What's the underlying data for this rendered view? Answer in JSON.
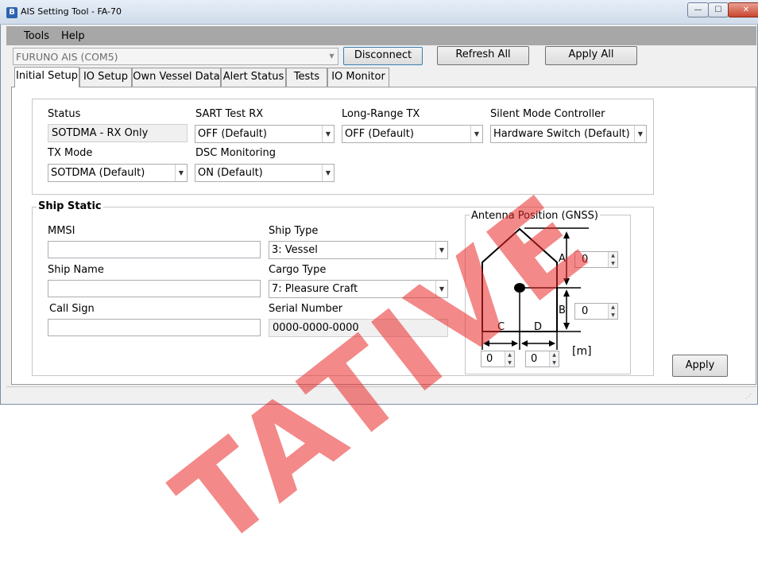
{
  "window": {
    "title": "AIS Setting Tool - FA-70",
    "app_icon": "B",
    "min": "—",
    "max": "☐",
    "close": "✕"
  },
  "menu": {
    "tools": "Tools",
    "help": "Help"
  },
  "connection": {
    "port": "FURUNO AIS (COM5)",
    "disconnect": "Disconnect",
    "refresh_all": "Refresh All",
    "apply_all": "Apply All"
  },
  "tabs": [
    "Initial Setup",
    "IO Setup",
    "Own Vessel Data",
    "Alert Status",
    "Tests",
    "IO Monitor"
  ],
  "initial_setup": {
    "status_label": "Status",
    "status_value": "SOTDMA - RX Only",
    "sart_label": "SART Test RX",
    "sart_value": "OFF (Default)",
    "longrange_label": "Long-Range TX",
    "longrange_value": "OFF (Default)",
    "silent_label": "Silent Mode Controller",
    "silent_value": "Hardware Switch (Default)",
    "txmode_label": "TX Mode",
    "txmode_value": "SOTDMA (Default)",
    "dsc_label": "DSC Monitoring",
    "dsc_value": "ON (Default)"
  },
  "ship_static": {
    "title": "Ship Static",
    "mmsi_label": "MMSI",
    "mmsi_value": "",
    "shipname_label": "Ship Name",
    "shipname_value": "",
    "callsign_label": "Call Sign",
    "callsign_value": "",
    "shiptype_label": "Ship Type",
    "shiptype_value": "3: Vessel",
    "cargotype_label": "Cargo Type",
    "cargotype_value": "7: Pleasure Craft",
    "serial_label": "Serial Number",
    "serial_value": "0000-0000-0000"
  },
  "antenna": {
    "title": "Antenna Position (GNSS)",
    "label_a": "A",
    "label_b": "B",
    "label_c": "C",
    "label_d": "D",
    "value_a": "0",
    "value_b": "0",
    "value_c": "0",
    "value_d": "0",
    "unit": "[m]"
  },
  "apply": "Apply",
  "watermark": "TATIVE"
}
